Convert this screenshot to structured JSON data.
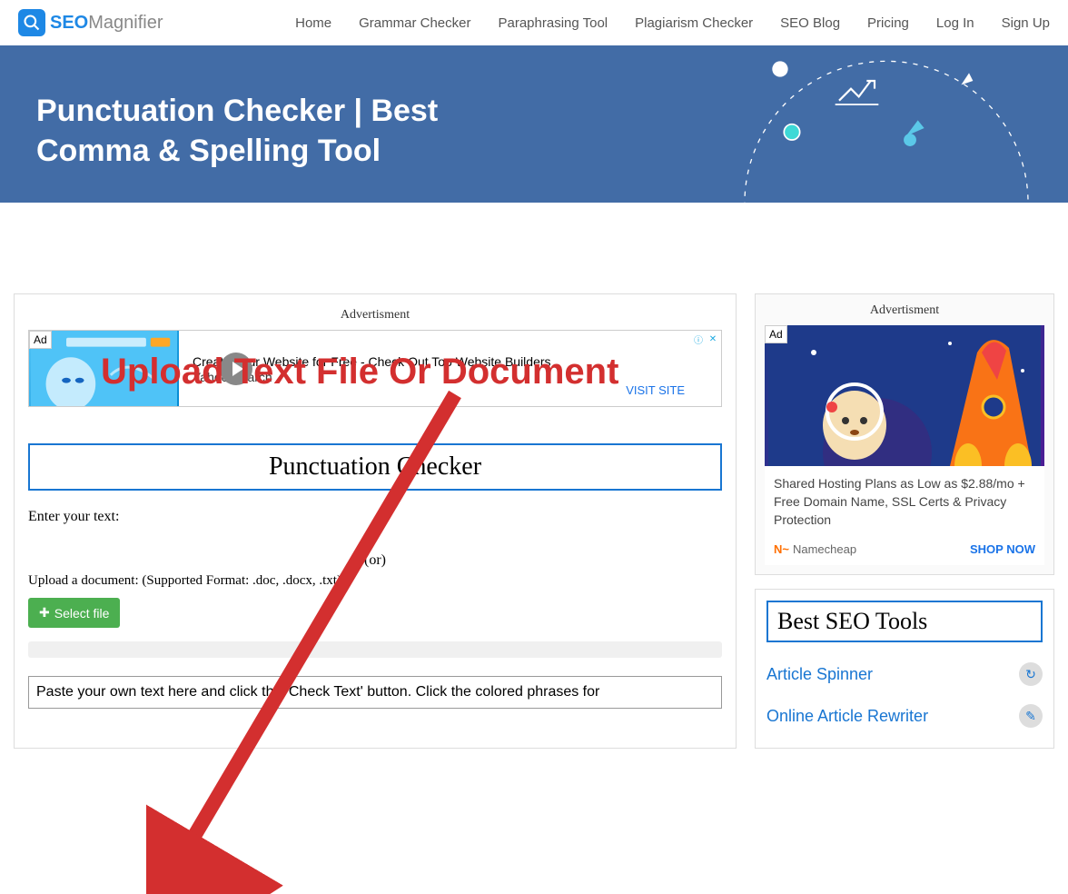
{
  "header": {
    "logo": {
      "seo": "SEO",
      "mag": "Magnifier"
    },
    "nav": [
      "Home",
      "Grammar Checker",
      "Paraphrasing Tool",
      "Plagiarism Checker",
      "SEO Blog",
      "Pricing",
      "Log In",
      "Sign Up"
    ]
  },
  "hero": {
    "title": "Punctuation Checker | Best Comma & Spelling Tool"
  },
  "main": {
    "ad_label": "Advertisment",
    "ad_badge": "Ad",
    "ad_title": "Create Your Website for Free - Check Out Top Website Builders",
    "ad_sub": "Yahoo Search",
    "ad_visit": "VISIT SITE",
    "tool_title": "Punctuation Checker",
    "enter_label": "Enter your text:",
    "or_label": "(or)",
    "upload_label": "Upload a document: (Supported Format: .doc, .docx, .txt)",
    "select_btn": "Select file",
    "textarea_placeholder": "Paste your own text here and click the 'Check Text' button. Click the colored phrases for"
  },
  "callout": "Upload Text File Or Document",
  "sidebar": {
    "ad_label": "Advertisment",
    "ad_badge": "Ad",
    "ad_text": "Shared Hosting Plans as Low as $2.88/mo + Free Domain Name, SSL Certs & Privacy Protection",
    "ad_brand": "Namecheap",
    "ad_cta": "SHOP NOW",
    "tools_title": "Best SEO Tools",
    "tools": [
      {
        "label": "Article Spinner",
        "icon": "↻"
      },
      {
        "label": "Online Article Rewriter",
        "icon": "✎"
      }
    ]
  }
}
